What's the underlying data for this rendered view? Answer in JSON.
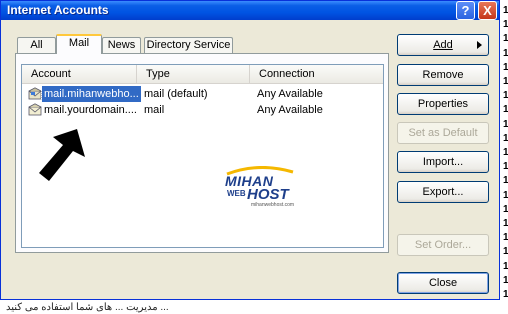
{
  "window": {
    "title": "Internet Accounts",
    "help_label": "?",
    "close_label": "X"
  },
  "tabs": [
    {
      "label": "All",
      "active": false
    },
    {
      "label": "Mail",
      "active": true
    },
    {
      "label": "News",
      "active": false
    },
    {
      "label": "Directory Service",
      "active": false
    }
  ],
  "list": {
    "columns": [
      "Account",
      "Type",
      "Connection"
    ],
    "rows": [
      {
        "account": "mail.mihanwebho...",
        "type": "mail (default)",
        "connection": "Any Available",
        "selected": true
      },
      {
        "account": "mail.yourdomain....",
        "type": "mail",
        "connection": "Any Available",
        "selected": false
      }
    ]
  },
  "buttons": {
    "add": "Add",
    "remove": "Remove",
    "properties": "Properties",
    "set_default": "Set as Default",
    "import": "Import...",
    "export": "Export...",
    "set_order": "Set Order...",
    "close": "Close"
  },
  "logo": {
    "line1": "MIHAN",
    "line2": "HOST",
    "web": "WEB",
    "tagline": "mihanwebhost.com"
  },
  "side_digits": [
    "1",
    "1",
    "1",
    "1",
    "1",
    "1",
    "1",
    "1",
    "1",
    "1",
    "1",
    "1",
    "1",
    "1",
    "1",
    "1",
    "1",
    "1",
    "1",
    "1",
    "1"
  ],
  "bottom_text": "... مدیریت ... های شما استفاده می کنید"
}
